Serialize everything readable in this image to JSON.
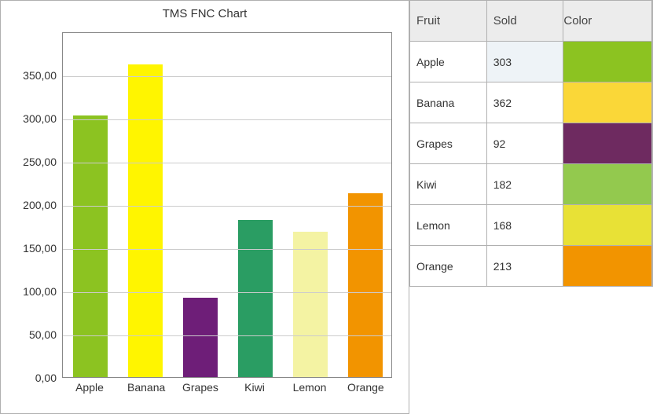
{
  "chart_data": {
    "type": "bar",
    "title": "TMS FNC Chart",
    "xlabel": "",
    "ylabel": "",
    "categories": [
      "Apple",
      "Banana",
      "Grapes",
      "Kiwi",
      "Lemon",
      "Orange"
    ],
    "values": [
      303,
      362,
      92,
      182,
      168,
      213
    ],
    "colors": [
      "#8cc321",
      "#fff500",
      "#6e1e78",
      "#2a9d63",
      "#f4f3a3",
      "#f29400"
    ],
    "ylim": [
      0,
      400
    ],
    "y_ticks": [
      "0,00",
      "50,00",
      "100,00",
      "150,00",
      "200,00",
      "250,00",
      "300,00",
      "350,00"
    ],
    "y_tick_values": [
      0,
      50,
      100,
      150,
      200,
      250,
      300,
      350
    ],
    "grid": true
  },
  "table": {
    "headers": {
      "fruit": "Fruit",
      "sold": "Sold",
      "color": "Color"
    },
    "rows": [
      {
        "fruit": "Apple",
        "sold": "303",
        "color": "#8cc321"
      },
      {
        "fruit": "Banana",
        "sold": "362",
        "color": "#fad738"
      },
      {
        "fruit": "Grapes",
        "sold": "92",
        "color": "#6e2a60"
      },
      {
        "fruit": "Kiwi",
        "sold": "182",
        "color": "#93c94e"
      },
      {
        "fruit": "Lemon",
        "sold": "168",
        "color": "#e8e136"
      },
      {
        "fruit": "Orange",
        "sold": "213",
        "color": "#f29400"
      }
    ],
    "selected_cell": {
      "row": 0,
      "col": "sold"
    }
  }
}
